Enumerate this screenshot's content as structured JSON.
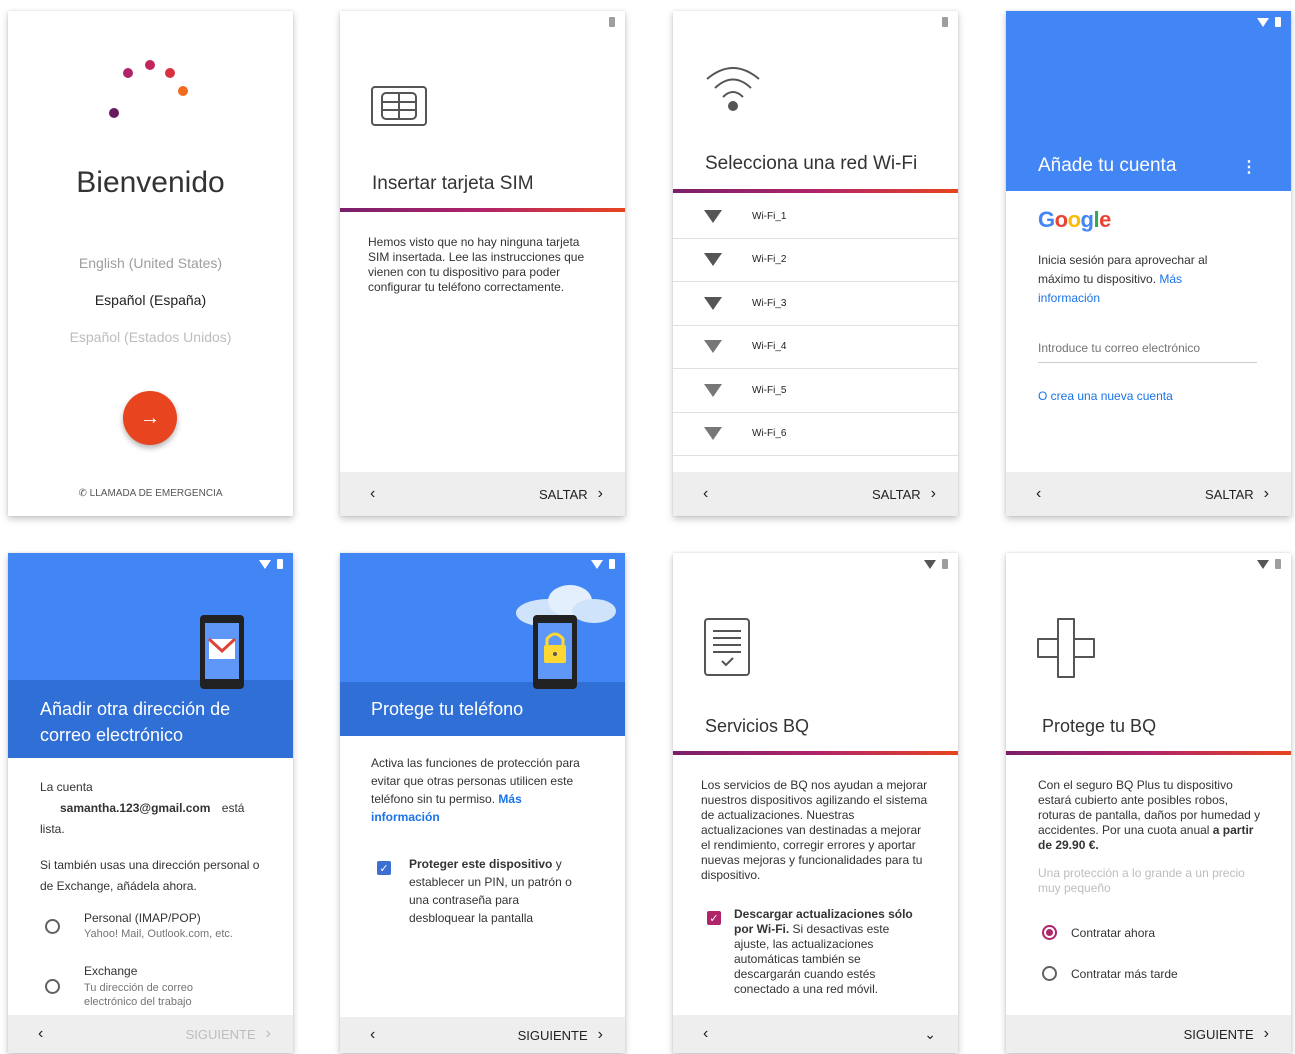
{
  "s1": {
    "title": "Bienvenido",
    "languages": [
      "English (United States)",
      "Español (España)",
      "Español (Estados Unidos)"
    ],
    "emergency": "LLAMADA DE EMERGENCIA",
    "next_icon": "arrow-right-icon",
    "accent": "#e8441f"
  },
  "s2": {
    "title": "Insertar tarjeta SIM",
    "body": "Hemos visto que no hay ninguna tarjeta SIM insertada. Lee las instrucciones que vienen con tu dispositivo para poder configurar tu teléfono correctamente.",
    "skip": "SALTAR"
  },
  "s3": {
    "title": "Selecciona una red Wi-Fi",
    "networks": [
      "Wi-Fi_1",
      "Wi-Fi_2",
      "Wi-Fi_3",
      "Wi-Fi_4",
      "Wi-Fi_5",
      "Wi-Fi_6"
    ],
    "skip": "SALTAR"
  },
  "s4": {
    "title": "Añade tu cuenta",
    "google": "Google",
    "intro": "Inicia sesión para aprovechar al máximo tu dispositivo.",
    "intro_link": "Más información",
    "email_placeholder": "Introduce tu correo electrónico",
    "create": "O crea una nueva cuenta",
    "skip": "SALTAR",
    "brand_color": "#4285f4"
  },
  "s5": {
    "title": "Añadir otra dirección de correo electrónico",
    "account_prefix": "La cuenta",
    "account_email": "samantha.123@gmail.com",
    "account_suffix": "está lista.",
    "prompt": "Si también usas una dirección personal o de Exchange, añádela ahora.",
    "options": [
      {
        "label": "Personal (IMAP/POP)",
        "sub": "Yahoo! Mail, Outlook.com, etc."
      },
      {
        "label": "Exchange",
        "sub": "Tu dirección de correo electrónico del trabajo"
      }
    ],
    "next": "SIGUIENTE"
  },
  "s6": {
    "title": "Protege tu teléfono",
    "body": "Activa las funciones de protección para evitar que otras personas utilicen este teléfono sin tu permiso.",
    "body_link": "Más información",
    "check_bold": "Proteger este dispositivo",
    "check_rest": " y establecer un PIN, un patrón o una contraseña para desbloquear la pantalla",
    "checked": true,
    "next": "SIGUIENTE"
  },
  "s7": {
    "title": "Servicios BQ",
    "body": "Los servicios de BQ nos ayudan a mejorar nuestros dispositivos agilizando el sistema de actualizaciones. Nuestras actualizaciones van destinadas a mejorar el rendimiento, corregir errores y aportar nuevas mejoras y funcionalidades para tu dispositivo.",
    "check_bold": "Descargar actualizaciones sólo por Wi-Fi.",
    "check_rest": " Si desactivas este ajuste, las actualizaciones automáticas también se descargarán cuando estés conectado a una red móvil.",
    "checked": true
  },
  "s8": {
    "title": "Protege tu BQ",
    "body_start": "Con el seguro BQ Plus tu dispositivo estará cubierto ante posibles robos, roturas de pantalla, daños por humedad y accidentes. Por una cuota anual ",
    "body_bold": "a partir de 29.90 €.",
    "tagline": "Una protección a lo grande a un precio muy pequeño",
    "options": [
      "Contratar ahora",
      "Contratar más tarde"
    ],
    "selected": 0,
    "next": "SIGUIENTE"
  }
}
